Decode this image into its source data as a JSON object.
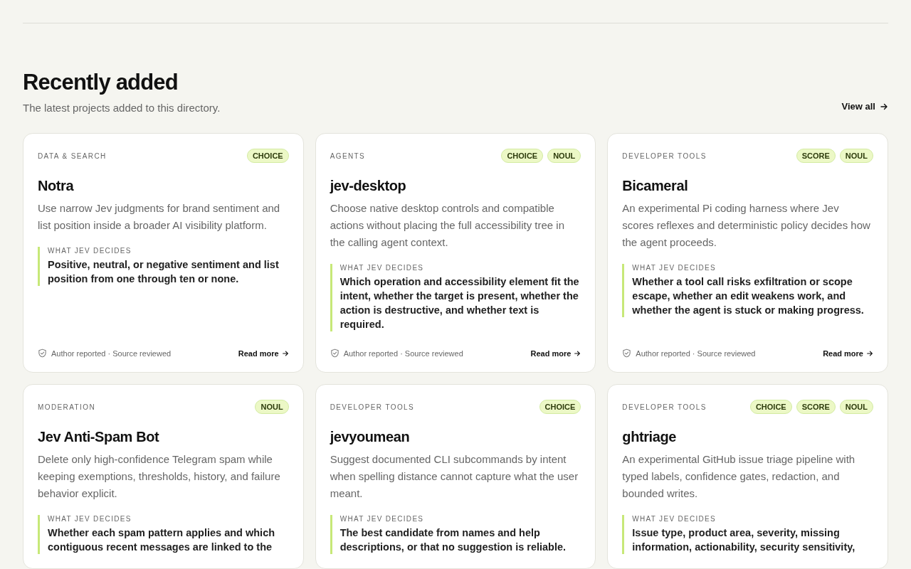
{
  "section": {
    "title": "Recently added",
    "subtitle": "The latest projects added to this directory.",
    "link": "View all"
  },
  "cards": [
    {
      "category": "DATA & SEARCH",
      "badges": [
        "CHOICE"
      ],
      "title": "Notra",
      "description": "Use narrow Jev judgments for brand sentiment and list position inside a broader AI visibility platform.",
      "decides_label": "WHAT JEV DECIDES",
      "decides": "Positive, neutral, or negative sentiment and list position from one through ten or none.",
      "footer": {
        "status": "Author reported · Source reviewed",
        "link": "Read more"
      }
    },
    {
      "category": "AGENTS",
      "badges": [
        "CHOICE",
        "NOUL"
      ],
      "title": "jev-desktop",
      "description": "Choose native desktop controls and compatible actions without placing the full accessibility tree in the calling agent context.",
      "decides_label": "WHAT JEV DECIDES",
      "decides": "Which operation and accessibility element fit the intent, whether the target is present, whether the action is destructive, and whether text is required.",
      "footer": {
        "status": "Author reported · Source reviewed",
        "link": "Read more"
      }
    },
    {
      "category": "DEVELOPER TOOLS",
      "badges": [
        "SCORE",
        "NOUL"
      ],
      "title": "Bicameral",
      "description": "An experimental Pi coding harness where Jev scores reflexes and deterministic policy decides how the agent proceeds.",
      "decides_label": "WHAT JEV DECIDES",
      "decides": "Whether a tool call risks exfiltration or scope escape, whether an edit weakens work, and whether the agent is stuck or making progress.",
      "footer": {
        "status": "Author reported · Source reviewed",
        "link": "Read more"
      }
    },
    {
      "category": "MODERATION",
      "badges": [
        "NOUL"
      ],
      "title": "Jev Anti-Spam Bot",
      "description": "Delete only high-confidence Telegram spam while keeping exemptions, thresholds, history, and failure behavior explicit.",
      "decides_label": "WHAT JEV DECIDES",
      "decides": "Whether each spam pattern applies and which contiguous recent messages are linked to the"
    },
    {
      "category": "DEVELOPER TOOLS",
      "badges": [
        "CHOICE"
      ],
      "title": "jevyoumean",
      "description": "Suggest documented CLI subcommands by intent when spelling distance cannot capture what the user meant.",
      "decides_label": "WHAT JEV DECIDES",
      "decides": "The best candidate from names and help descriptions, or that no suggestion is reliable."
    },
    {
      "category": "DEVELOPER TOOLS",
      "badges": [
        "CHOICE",
        "SCORE",
        "NOUL"
      ],
      "title": "ghtriage",
      "description": "An experimental GitHub issue triage pipeline with typed labels, confidence gates, redaction, and bounded writes.",
      "decides_label": "WHAT JEV DECIDES",
      "decides": "Issue type, product area, severity, missing information, actionability, security sensitivity,"
    }
  ]
}
